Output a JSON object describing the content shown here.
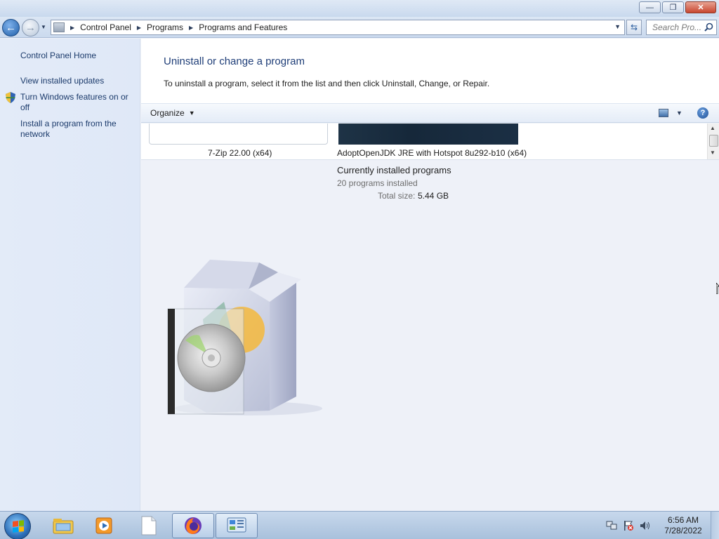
{
  "window": {
    "minimize_label": "—",
    "restore_label": "❐",
    "close_label": "✕"
  },
  "address_bar": {
    "breadcrumbs": [
      "Control Panel",
      "Programs",
      "Programs and Features"
    ],
    "search_placeholder": "Search Pro..."
  },
  "sidebar": {
    "items": [
      {
        "label": "Control Panel Home"
      },
      {
        "label": "View installed updates"
      },
      {
        "label": "Turn Windows features on or off"
      },
      {
        "label": "Install a program from the network"
      }
    ]
  },
  "main": {
    "title": "Uninstall or change a program",
    "subtitle": "To uninstall a program, select it from the list and then click Uninstall, Change, or Repair.",
    "toolbar": {
      "organize_label": "Organize",
      "help_label": "?"
    },
    "programs": [
      {
        "name": "7-Zip 22.00 (x64)"
      },
      {
        "name": "AdoptOpenJDK JRE with Hotspot 8u292-b10 (x64)"
      }
    ],
    "details": {
      "title": "Currently installed programs",
      "count_text": "20 programs installed",
      "total_size_label": "Total size:",
      "total_size_value": "5.44 GB"
    }
  },
  "taskbar": {
    "pinned": [
      {
        "name": "windows-explorer-icon"
      },
      {
        "name": "media-player-icon"
      },
      {
        "name": "notepad-icon"
      },
      {
        "name": "firefox-icon"
      },
      {
        "name": "control-panel-icon"
      }
    ],
    "clock": {
      "time": "6:56 AM",
      "date": "7/28/2022"
    }
  }
}
